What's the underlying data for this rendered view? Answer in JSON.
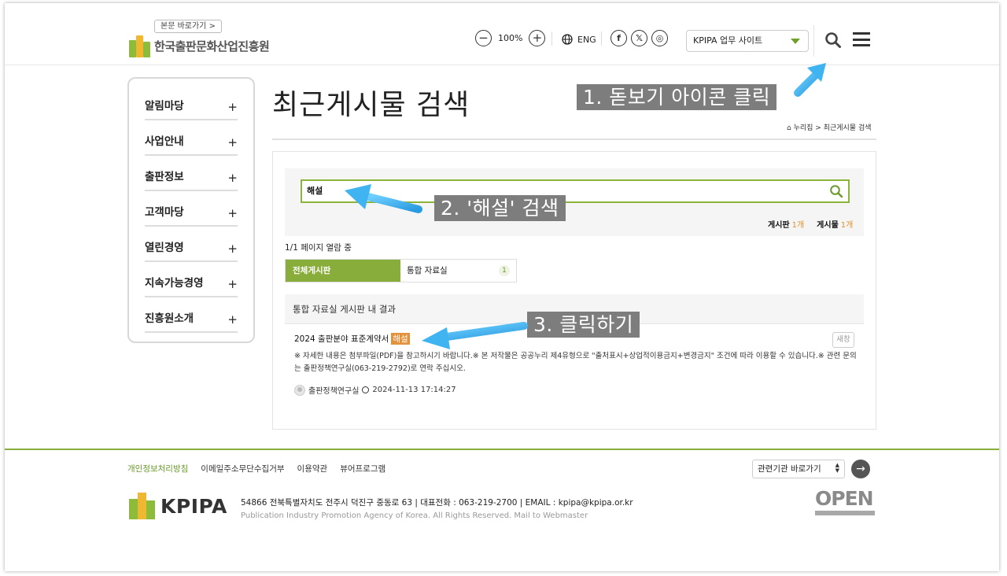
{
  "header": {
    "skip_link": "본문 바로가기 >",
    "logo_text": "한국출판문화산업진흥원",
    "zoom_minus": "−",
    "zoom_level": "100%",
    "zoom_plus": "+",
    "lang_label": "ENG",
    "social": [
      "f",
      "𝕏",
      "◎"
    ],
    "site_select": "KPIPA 업무 사이트"
  },
  "sidebar": {
    "items": [
      {
        "label": "알림마당",
        "plus": "+"
      },
      {
        "label": "사업안내",
        "plus": "+"
      },
      {
        "label": "출판정보",
        "plus": "+"
      },
      {
        "label": "고객마당",
        "plus": "+"
      },
      {
        "label": "열린경영",
        "plus": "+"
      },
      {
        "label": "지속가능경영",
        "plus": "+"
      },
      {
        "label": "진흥원소개",
        "plus": "+"
      }
    ]
  },
  "main": {
    "page_title": "최근게시물 검색",
    "breadcrumb": "누리집 > 최근게시물 검색",
    "search_value": "해설",
    "counts": {
      "board_label": "게시판",
      "board_count": "1개",
      "post_label": "게시물",
      "post_count": "1개"
    },
    "page_info": "1/1 페이지 열람 중",
    "tabs": [
      {
        "label": "전체게시판"
      },
      {
        "label": "통합 자료실",
        "count": "1"
      }
    ],
    "result_heading": "통합 자료실 게시판 내 결과",
    "result": {
      "title_prefix": "2024 출판분야 표준계약서",
      "title_highlight": "해설",
      "new_window": "새창",
      "description": "※ 자세한 내용은 첨부파일(PDF)을 참고하시기 바랍니다.※ 본 저작물은 공공누리 제4유형으로 \"출처표시+상업적이용금지+변경금지\" 조건에 따라 이용할 수 있습니다.※ 관련 문의는 출판정책연구실(063-219-2792)로 연락 주십시오.",
      "author": "출판정책연구실",
      "datetime": "2024-11-13 17:14:27"
    }
  },
  "annotations": {
    "step1": "1. 돋보기 아이콘 클릭",
    "step2": "2. '해설' 검색",
    "step3": "3. 클릭하기"
  },
  "footer": {
    "links": [
      "개인정보처리방침",
      "이메일주소무단수집거부",
      "이용약관",
      "뷰어프로그램"
    ],
    "related_select": "관련기관 바로가기",
    "logo_word": "KPIPA",
    "address": "54866 전북특별자치도 전주시 덕진구 중동로 63  |  대표전화 : 063-219-2700  |  EMAIL : kpipa@kpipa.or.kr",
    "copyright": "Publication Industry Promotion Agency of Korea. All Rights Reserved. Mail to Webmaster",
    "open_logo": "OPEN"
  },
  "colors": {
    "brand_green": "#88ad3a",
    "highlight_orange": "#e3913a",
    "callout_gray": "#7d7d7d",
    "arrow_blue": "#3fb4f0"
  }
}
